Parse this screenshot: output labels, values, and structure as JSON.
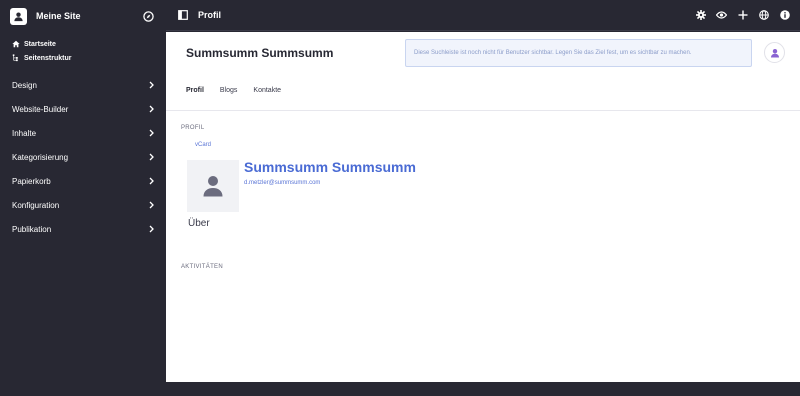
{
  "sidebar": {
    "site_name": "Meine Site",
    "quick_links": [
      {
        "label": "Startseite",
        "icon": "home-icon"
      },
      {
        "label": "Seitenstruktur",
        "icon": "tree-icon"
      }
    ],
    "items": [
      {
        "label": "Design"
      },
      {
        "label": "Website-Builder"
      },
      {
        "label": "Inhalte"
      },
      {
        "label": "Kategorisierung"
      },
      {
        "label": "Papierkorb"
      },
      {
        "label": "Konfiguration"
      },
      {
        "label": "Publikation"
      }
    ]
  },
  "topbar": {
    "title": "Profil",
    "icons": [
      "gear-icon",
      "eye-icon",
      "plus-icon",
      "globe-icon",
      "info-icon"
    ]
  },
  "profile": {
    "name": "Summsumm Summsumm",
    "search_notice": "Diese Suchleiste ist noch nicht für Benutzer sichtbar. Legen Sie das Ziel fest, um es sichtbar zu machen.",
    "tabs": [
      {
        "label": "Profil",
        "active": true
      },
      {
        "label": "Blogs",
        "active": false
      },
      {
        "label": "Kontakte",
        "active": false
      }
    ],
    "section_profile": "PROFIL",
    "vcard_label": "vCard",
    "display_name": "Summsumm Summsumm",
    "email": "d.metzler@summsumm.com",
    "about_label": "Über",
    "section_activities": "AKTIVITÄTEN"
  },
  "colors": {
    "dark_bg": "#282833",
    "accent": "#4a6bd4",
    "link": "#5a75d6",
    "avatar_purple": "#8a63d2"
  }
}
